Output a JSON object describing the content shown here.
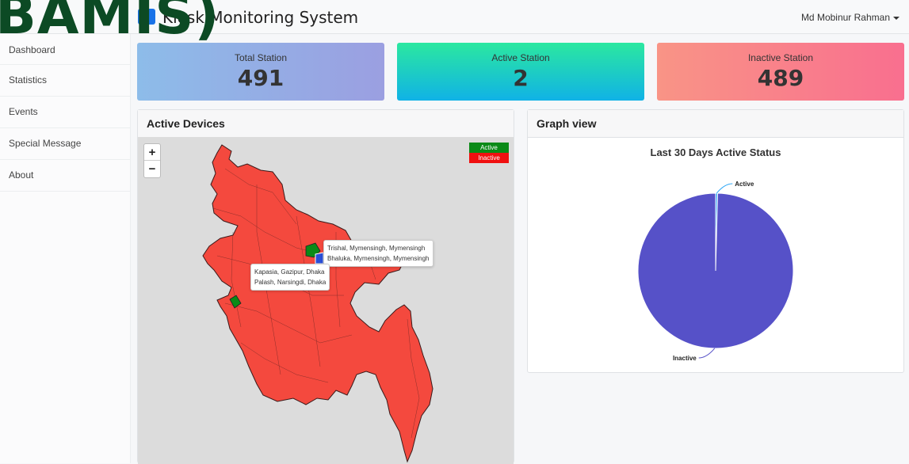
{
  "watermark": "BAMIS)",
  "header": {
    "title": "Kiosk Monitoring System",
    "user": "Md Mobinur Rahman"
  },
  "sidebar": {
    "items": [
      {
        "label": "Dashboard"
      },
      {
        "label": "Statistics"
      },
      {
        "label": "Events"
      },
      {
        "label": "Special Message"
      },
      {
        "label": "About"
      }
    ]
  },
  "stats": [
    {
      "label": "Total Station",
      "value": "491"
    },
    {
      "label": "Active Station",
      "value": "2"
    },
    {
      "label": "Inactive Station",
      "value": "489"
    }
  ],
  "map": {
    "title": "Active Devices",
    "zoom_in": "+",
    "zoom_out": "−",
    "legend": {
      "active": "Active",
      "inactive": "Inactive"
    },
    "tooltips": [
      "Trishal, Mymensingh, Mymensingh",
      "Bhaluka, Mymensingh, Mymensingh",
      "Kapasia, Gazipur, Dhaka",
      "Palash, Narsingdi, Dhaka"
    ],
    "colors": {
      "active": "#0b8a17",
      "inactive": "#f4493e"
    }
  },
  "graph": {
    "title": "Graph view"
  },
  "chart_data": {
    "type": "pie",
    "title": "Last 30 Days Active Status",
    "categories": [
      "Active",
      "Inactive"
    ],
    "values": [
      2,
      489
    ],
    "colors": [
      "#2ba6f6",
      "#5651c8"
    ]
  }
}
